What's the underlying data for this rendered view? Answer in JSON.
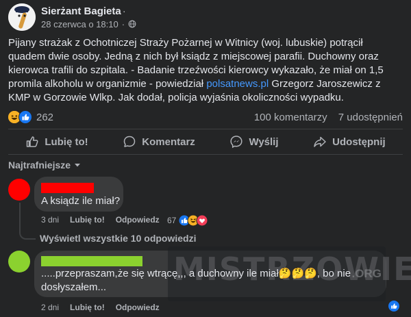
{
  "post": {
    "author": "Sierżant Bagieta",
    "author_dot": "·",
    "timestamp": "28 czerwca o 18:10",
    "meta_dot": "·",
    "text_before_link": "Pijany strażak z Ochotniczej Straży Pożarnej w Witnicy (woj. lubuskie) potrącił quadem dwie osoby. Jedną z nich był ksiądz z miejscowej parafii. Duchowny oraz kierowca trafili do szpitala. - Badanie trzeźwości kierowcy wykazało, że miał on 1,5 promila alkoholu w organizmie - powiedział ",
    "link_text": "polsatnews.pl",
    "text_after_link": " Grzegorz Jaroszewicz z KMP w Gorzowie Wlkp. Jak dodał, policja wyjaśnia okoliczności wypadku."
  },
  "stats": {
    "reaction_count": "262",
    "comments": "100 komentarzy",
    "shares": "7 udostępnień"
  },
  "actions": {
    "like": "Lubię to!",
    "comment": "Komentarz",
    "send": "Wyślij",
    "share": "Udostępnij"
  },
  "sort_label": "Najtrafniejsze",
  "comments": [
    {
      "text": "A ksiądz ile miał?",
      "time": "3 dni",
      "like": "Lubię to!",
      "reply": "Odpowiedz",
      "reaction_count": "67",
      "avatar_color": "#ff0000",
      "name_color": "#ff0000"
    },
    {
      "text_line1": ".....przepraszam,że się wtrącę,,, a duchowny ile miał🤔🤔🤔, bo nie",
      "text_line2": "dosłyszałem...",
      "time": "2 dni",
      "like": "Lubię to!",
      "reply": "Odpowiedz",
      "avatar_color": "#8bd12f",
      "name_color": "#8bd12f"
    }
  ],
  "replies_link": "Wyświetl wszystkie 10 odpowiedzi",
  "watermark": {
    "main": "MISTRZOWIE",
    "sub": ".ORG"
  },
  "colors": {
    "background": "#242526",
    "link": "#4599ff",
    "like_blue": "#1877f2"
  }
}
